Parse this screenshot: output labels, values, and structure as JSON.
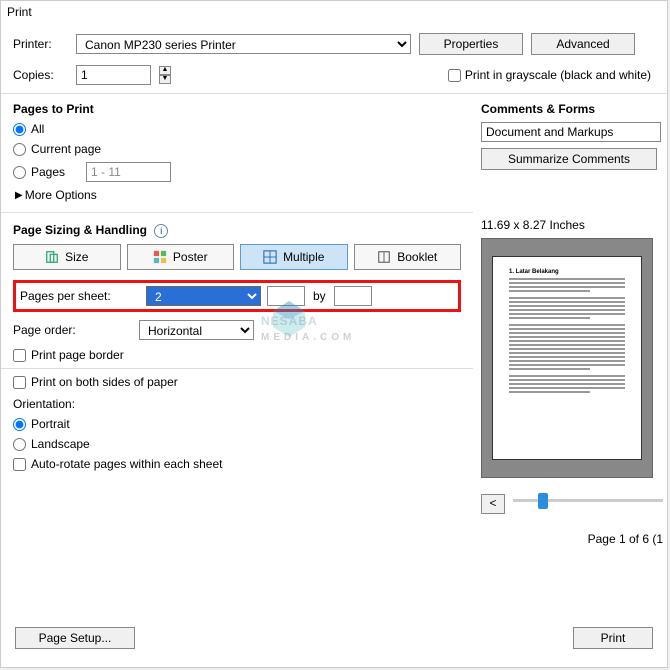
{
  "window_title": "Print",
  "printer": {
    "label": "Printer:",
    "value": "Canon MP230 series Printer",
    "properties_btn": "Properties",
    "advanced_btn": "Advanced"
  },
  "copies": {
    "label": "Copies:",
    "value": "1"
  },
  "grayscale": {
    "label": "Print in grayscale (black and white)"
  },
  "pages_to_print": {
    "title": "Pages to Print",
    "all": "All",
    "current": "Current page",
    "pages": "Pages",
    "pages_range": "1 - 11",
    "more": "More Options"
  },
  "comments": {
    "title": "Comments & Forms",
    "value": "Document and Markups",
    "summarize": "Summarize Comments"
  },
  "sizing": {
    "title": "Page Sizing & Handling",
    "size": "Size",
    "poster": "Poster",
    "multiple": "Multiple",
    "booklet": "Booklet"
  },
  "pps": {
    "label": "Pages per sheet:",
    "value": "2",
    "by": "by",
    "order_label": "Page order:",
    "order_value": "Horizontal",
    "border": "Print page border"
  },
  "both_sides": "Print on both sides of paper",
  "orientation": {
    "title": "Orientation:",
    "portrait": "Portrait",
    "landscape": "Landscape",
    "auto": "Auto-rotate pages within each sheet"
  },
  "preview": {
    "dims": "11.69 x 8.27 Inches",
    "page_of": "Page 1 of 6 (1"
  },
  "bottom": {
    "setup": "Page Setup...",
    "print": "Print"
  },
  "watermark": {
    "main": "NESABA",
    "sub": "MEDIA.COM"
  }
}
